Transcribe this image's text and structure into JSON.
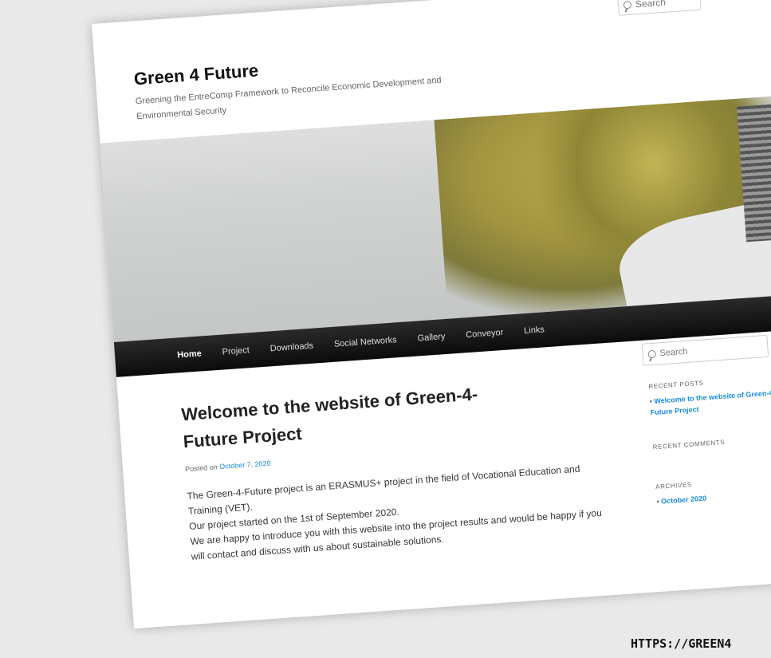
{
  "header": {
    "search_placeholder": "Search",
    "site_title": "Green 4 Future",
    "site_description": "Greening the EntreComp Framework to Reconcile Economic Development and Environmental Security"
  },
  "nav": {
    "items": [
      "Home",
      "Project",
      "Downloads",
      "Social Networks",
      "Gallery",
      "Conveyor",
      "Links"
    ]
  },
  "post": {
    "title": "Welcome to the website of Green-4-Future Project",
    "posted_on": "Posted on",
    "date": "October 7, 2020",
    "paragraph1": "The Green-4-Future project is an ERASMUS+ project in the field of Vocational Education and Training (VET).",
    "paragraph2": "Our project started on the 1st of September 2020.",
    "paragraph3": "We are happy to introduce you with this website into the project results and would be happy if you will contact and discuss with us about sustainable solutions."
  },
  "sidebar": {
    "search_placeholder": "Search",
    "recent_posts_heading": "RECENT POSTS",
    "recent_post_link": "Welcome to the website of Green-4-Future Project",
    "recent_comments_heading": "RECENT COMMENTS",
    "archives_heading": "ARCHIVES",
    "archive_link": "October 2020"
  },
  "overlay": {
    "url_text": "HTTPS://GREEN4"
  },
  "colors": {
    "link": "#1b8be0",
    "nav_bg": "#0b0b0b"
  }
}
